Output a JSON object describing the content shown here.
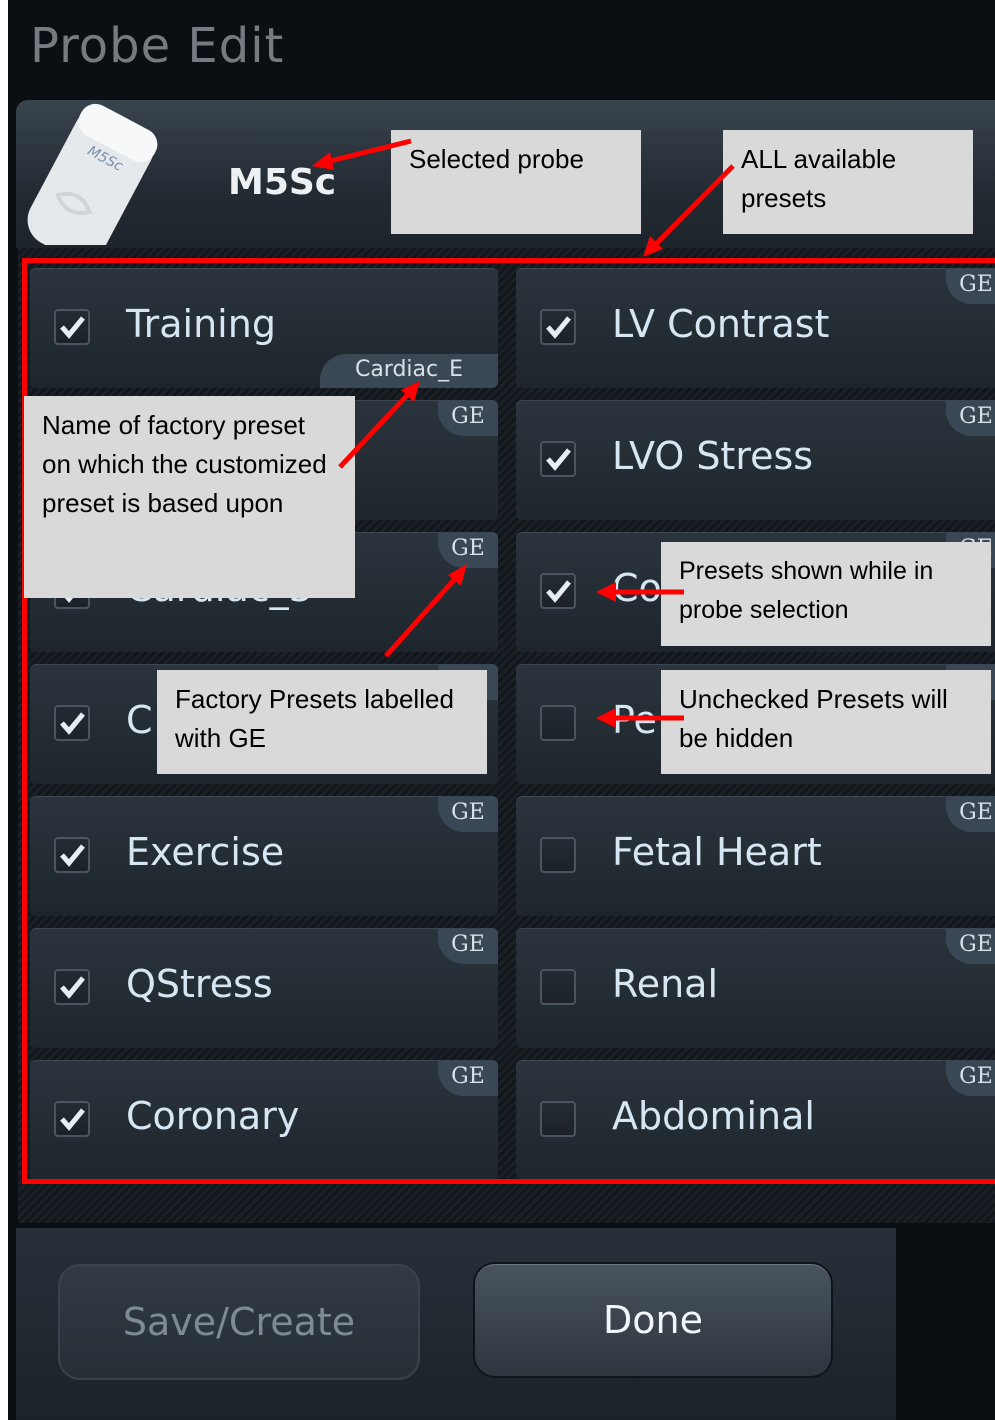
{
  "window": {
    "title": "Probe Edit"
  },
  "probe": {
    "name": "M5Sc",
    "image_label": "M5Sc"
  },
  "presets": [
    {
      "label": "Training",
      "checked": true,
      "badge": "Cardiac_E"
    },
    {
      "label": "LV Contrast",
      "checked": true,
      "badge": "GE"
    },
    {
      "label": "",
      "checked": true,
      "badge": "GE"
    },
    {
      "label": "LVO Stress",
      "checked": true,
      "badge": "GE"
    },
    {
      "label": "Cardiac_3",
      "checked": true,
      "badge": "GE"
    },
    {
      "label": "Co",
      "checked": true,
      "badge": "GE"
    },
    {
      "label": "C",
      "checked": true,
      "badge": "GE"
    },
    {
      "label": "Pe",
      "checked": false,
      "badge": "GE"
    },
    {
      "label": "Exercise",
      "checked": true,
      "badge": "GE"
    },
    {
      "label": "Fetal Heart",
      "checked": false,
      "badge": "GE"
    },
    {
      "label": "QStress",
      "checked": true,
      "badge": "GE"
    },
    {
      "label": "Renal",
      "checked": false,
      "badge": "GE"
    },
    {
      "label": "Coronary",
      "checked": true,
      "badge": "GE"
    },
    {
      "label": "Abdominal",
      "checked": false,
      "badge": "GE"
    }
  ],
  "buttons": {
    "save": "Save/Create",
    "done": "Done"
  },
  "callouts": {
    "selected_probe": "Selected probe",
    "all_presets": "ALL available presets",
    "factory_name": "Name of factory preset on which the customized preset is based upon",
    "shown_presets": "Presets shown while in probe selection",
    "factory_ge": "Factory Presets labelled with GE",
    "unchecked": "Unchecked Presets will be hidden"
  },
  "colors": {
    "annotation_red": "#ff0000",
    "callout_bg": "#d9d9d9",
    "label_text": "#d6e6f3",
    "panel_bg": "#0b0e12"
  }
}
